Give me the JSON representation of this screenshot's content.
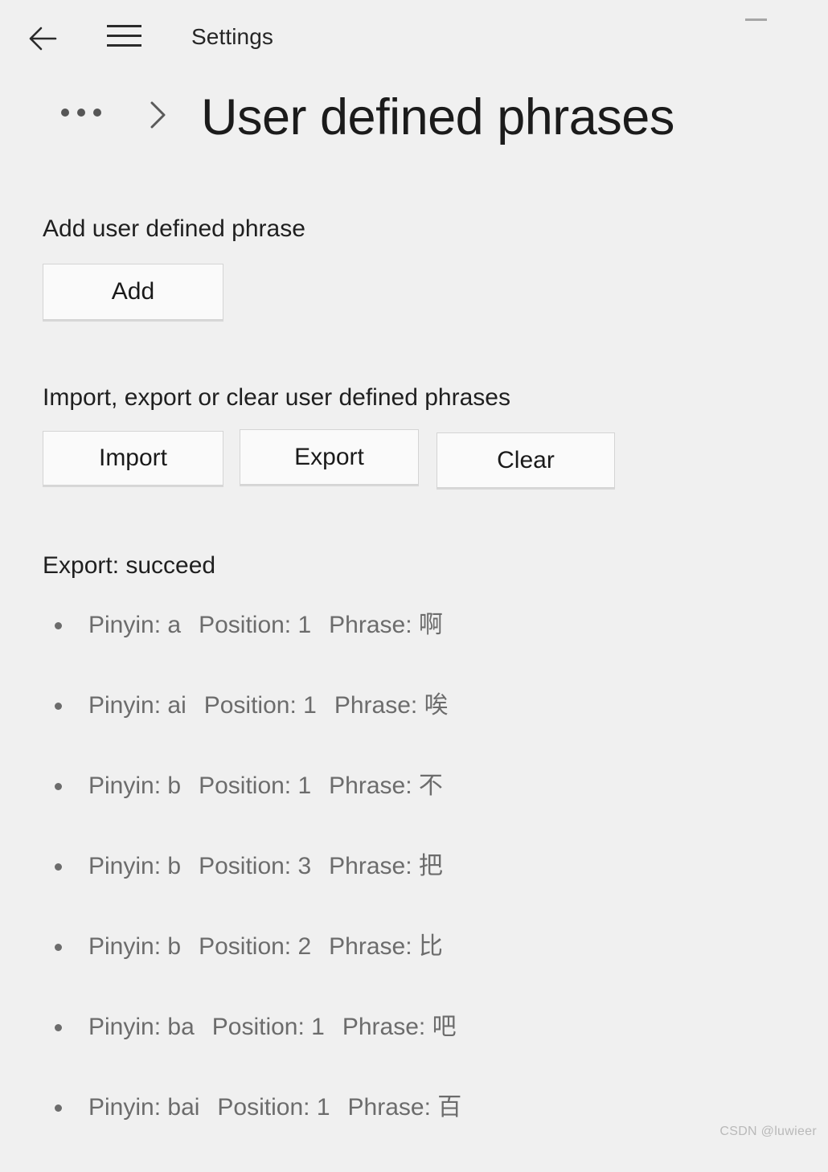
{
  "window": {
    "app_title": "Settings",
    "back_icon": "back-arrow-icon",
    "menu_icon": "hamburger-menu-icon",
    "minimize_icon": "minimize-icon"
  },
  "header": {
    "breadcrumb_overflow": "•••",
    "breadcrumb_separator": "chevron-right-icon",
    "page_title": "User defined phrases"
  },
  "sections": {
    "add": {
      "label": "Add user defined phrase",
      "add_button": "Add"
    },
    "io": {
      "label": "Import, export or clear user defined phrases",
      "import_button": "Import",
      "export_button": "Export",
      "clear_button": "Clear"
    }
  },
  "status": {
    "text": "Export: succeed"
  },
  "phrases": {
    "field_labels": {
      "pinyin": "Pinyin:",
      "position": "Position:",
      "phrase": "Phrase:"
    },
    "items": [
      {
        "pinyin": "a",
        "position": "1",
        "phrase": "啊"
      },
      {
        "pinyin": "ai",
        "position": "1",
        "phrase": "唉"
      },
      {
        "pinyin": "b",
        "position": "1",
        "phrase": "不"
      },
      {
        "pinyin": "b",
        "position": "3",
        "phrase": "把"
      },
      {
        "pinyin": "b",
        "position": "2",
        "phrase": "比"
      },
      {
        "pinyin": "ba",
        "position": "1",
        "phrase": "吧"
      },
      {
        "pinyin": "bai",
        "position": "1",
        "phrase": "百"
      }
    ]
  },
  "watermark": {
    "text": "CSDN @luwieer"
  },
  "colors": {
    "page_background": "#f0f0f0",
    "button_fill": "#fafafa",
    "button_border": "#d4d4d4",
    "primary_text": "#1f1f1f",
    "secondary_text": "#6c6c6c",
    "watermark_text": "#b9b9b9"
  }
}
